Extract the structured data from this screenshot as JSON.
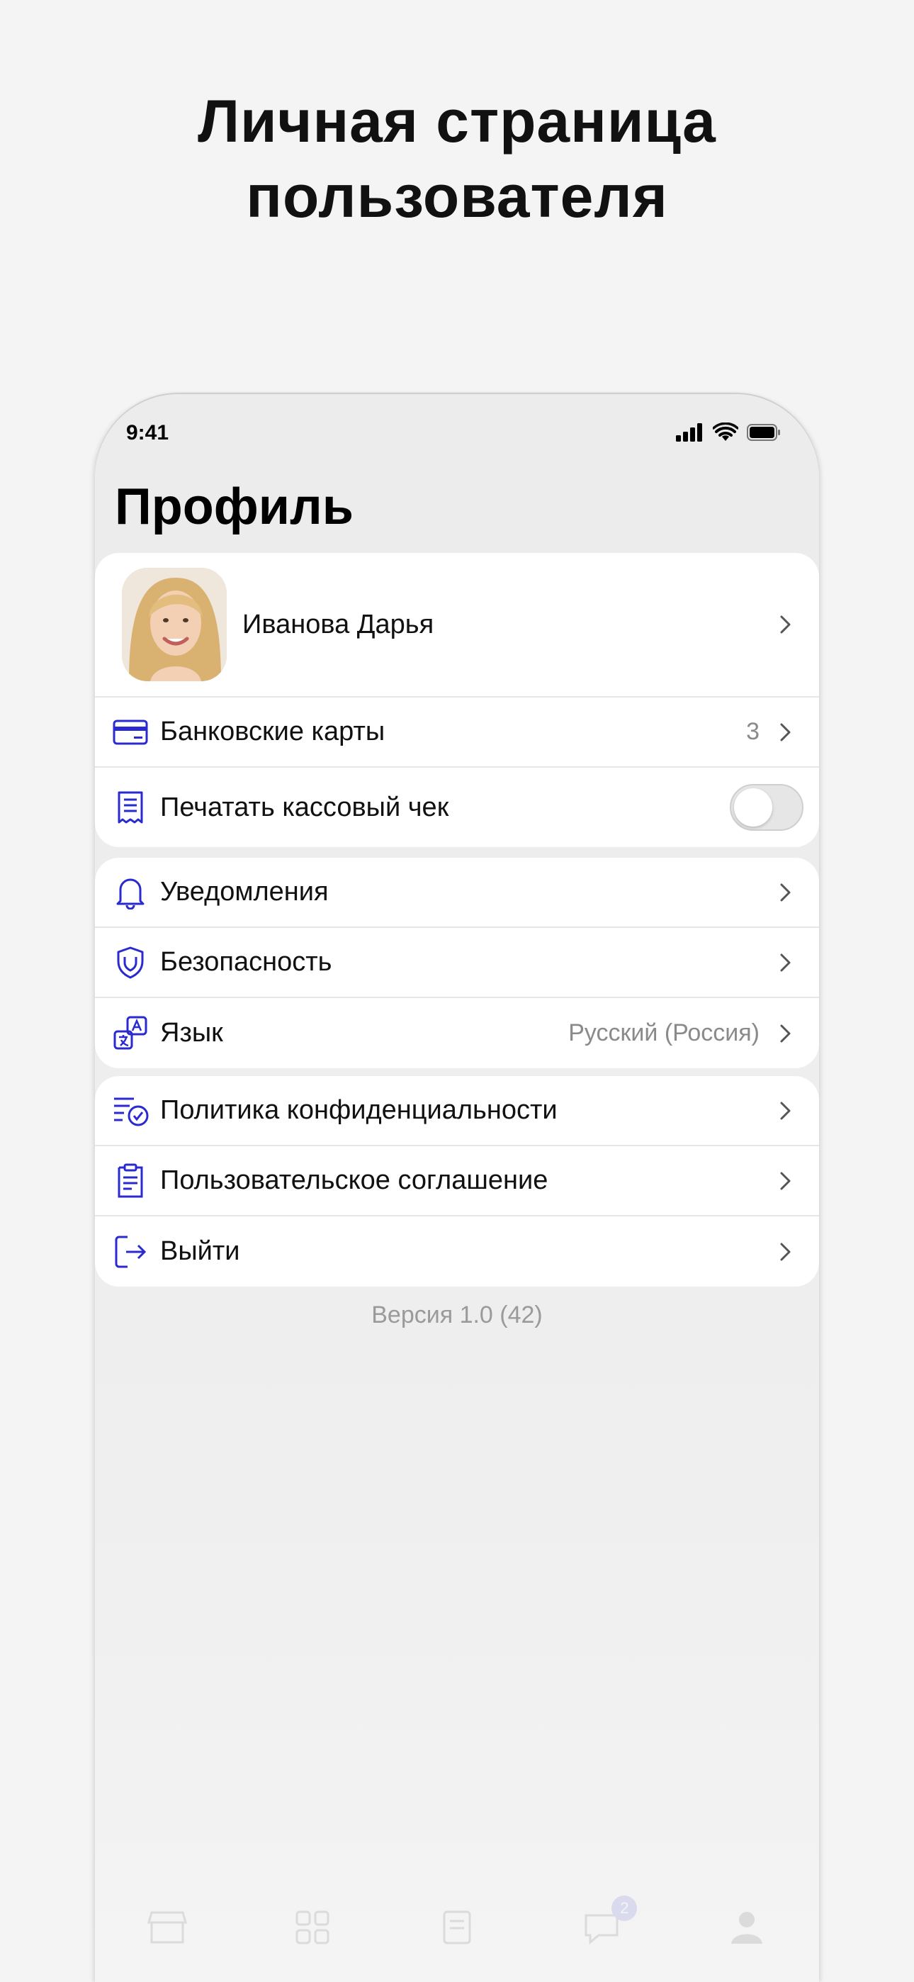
{
  "headline": {
    "line1": "Личная страница",
    "line2": "пользователя"
  },
  "status_bar": {
    "time": "9:41"
  },
  "screen": {
    "title": "Профиль"
  },
  "accent_color": "#2a2ad0",
  "profile": {
    "name": "Иванова Дарья",
    "avatar": "user-avatar-photo"
  },
  "group1": [
    {
      "icon": "credit-card-icon",
      "label": "Банковские карты",
      "value": "3"
    },
    {
      "icon": "receipt-icon",
      "label": "Печатать кассовый чек",
      "toggle_on": false
    }
  ],
  "group2": [
    {
      "icon": "bell-icon",
      "label": "Уведомления",
      "value": ""
    },
    {
      "icon": "shield-icon",
      "label": "Безопасность",
      "value": ""
    },
    {
      "icon": "translate-icon",
      "label": "Язык",
      "value": "Русский (Россия)"
    }
  ],
  "group3": [
    {
      "icon": "privacy-policy-icon",
      "label": "Политика конфиденциальности"
    },
    {
      "icon": "document-icon",
      "label": "Пользовательское соглашение"
    },
    {
      "icon": "logout-icon",
      "label": "Выйти"
    }
  ],
  "version": "Версия 1.0 (42)",
  "tabbar": {
    "badge_count": "2"
  }
}
